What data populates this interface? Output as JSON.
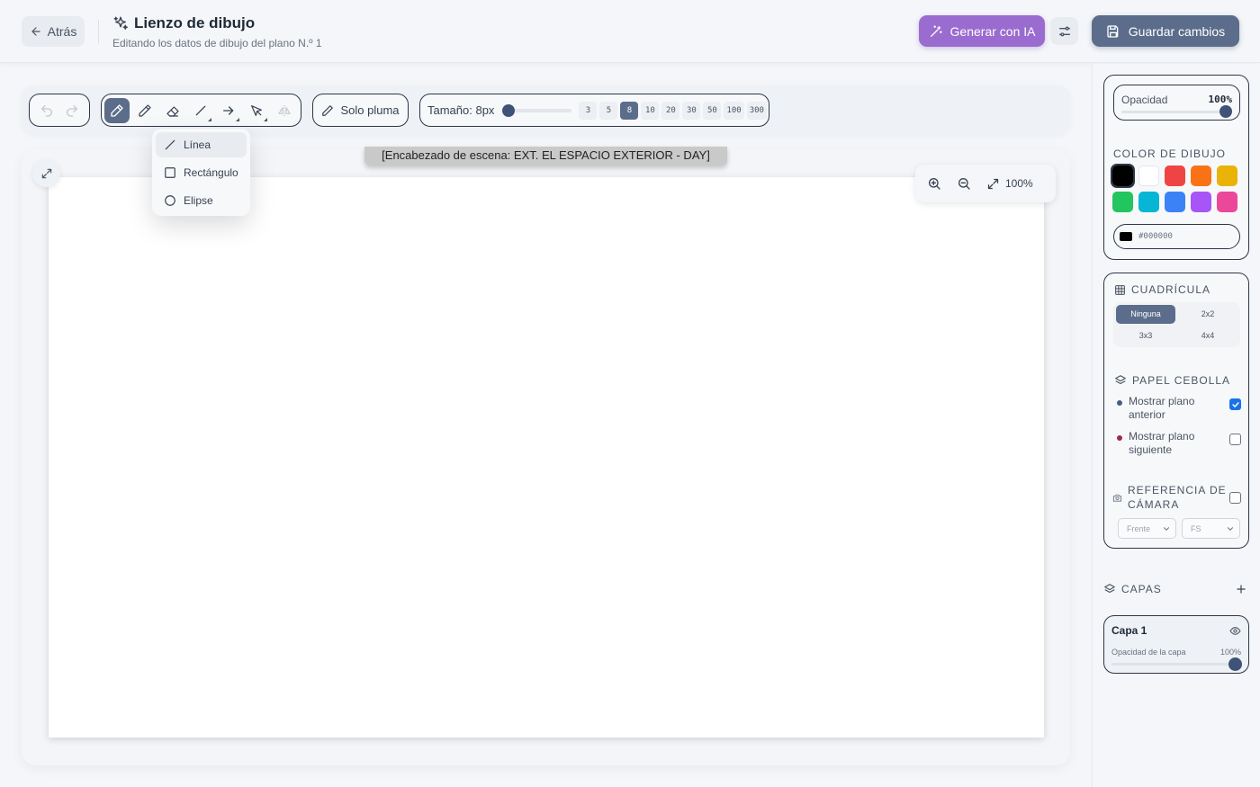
{
  "header": {
    "back_label": "Atrás",
    "title": "Lienzo de dibujo",
    "subtitle": "Editando los datos de dibujo del plano N.º 1",
    "ai_label": "Generar con IA",
    "save_label": "Guardar cambios"
  },
  "toolbar": {
    "pen_only_label": "Solo pluma",
    "size_label": "Tamaño: 8px",
    "size_value": 8,
    "sizes": [
      "3",
      "5",
      "8",
      "10",
      "20",
      "30",
      "50",
      "100",
      "300"
    ],
    "active_size": "8",
    "active_tool": "pen",
    "tools": [
      {
        "name": "pen-icon",
        "label": "pen"
      },
      {
        "name": "pencil-icon",
        "label": "pencil"
      },
      {
        "name": "eraser-icon",
        "label": "eraser"
      },
      {
        "name": "line-icon",
        "label": "line"
      },
      {
        "name": "arrow-icon",
        "label": "arrow"
      },
      {
        "name": "select-icon",
        "label": "select"
      },
      {
        "name": "flip-icon",
        "label": "flip"
      }
    ]
  },
  "shape_menu": {
    "items": [
      {
        "label": "Línea",
        "icon": "line-icon"
      },
      {
        "label": "Rectángulo",
        "icon": "rectangle-icon"
      },
      {
        "label": "Elipse",
        "icon": "ellipse-icon"
      }
    ],
    "active": "Línea"
  },
  "canvas": {
    "scene_heading": "[Encabezado de escena: EXT. EL ESPACIO EXTERIOR - DAY]",
    "zoom": "100%"
  },
  "panel": {
    "opacity_label": "Opacidad",
    "opacity_value": "100%",
    "color_title": "COLOR DE DIBUJO",
    "colors": [
      "#000000",
      "#ffffff",
      "#ef4444",
      "#f97316",
      "#eab308",
      "#22c55e",
      "#06b6d4",
      "#3b82f6",
      "#a855f7",
      "#ec4899"
    ],
    "selected_color": "#000000",
    "hex_value": "#000000",
    "grid_title": "CUADRÍCULA",
    "grid_options": [
      "Ninguna",
      "2x2",
      "3x3",
      "4x4"
    ],
    "grid_active": "Ninguna",
    "onion_title": "PAPEL CEBOLLA",
    "onion_prev": "Mostrar plano anterior",
    "onion_prev_checked": true,
    "onion_prev_color": "#4a5b86",
    "onion_next": "Mostrar plano siguiente",
    "onion_next_checked": false,
    "onion_next_color": "#9b2c4d",
    "camera_title": "REFERENCIA DE CÁMARA",
    "camera_checked": false,
    "camera_view": "Frente",
    "camera_shot": "FS"
  },
  "layers": {
    "title": "CAPAS",
    "items": [
      {
        "name": "Capa 1",
        "opacity_label": "Opacidad de la capa",
        "opacity_value": "100%"
      }
    ]
  }
}
